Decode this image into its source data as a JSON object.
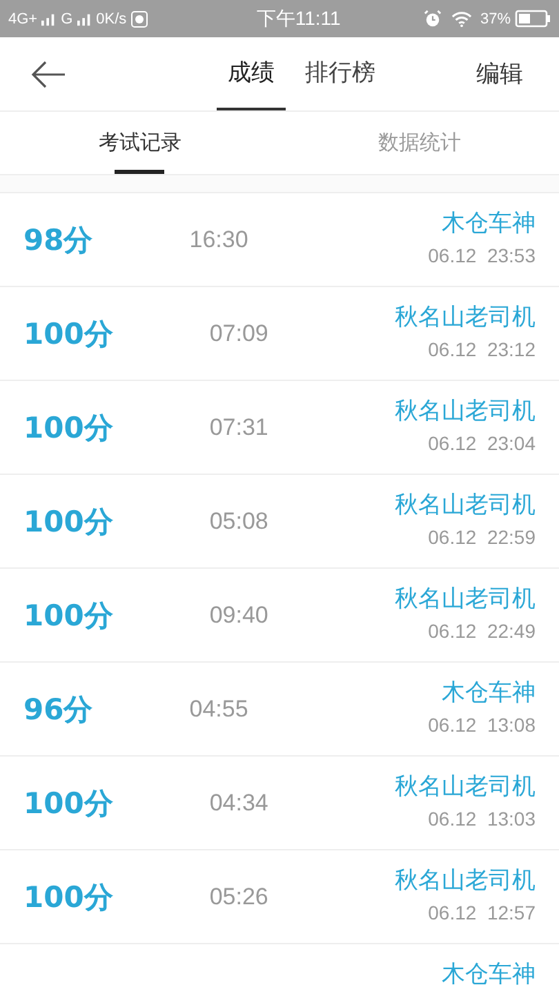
{
  "status_bar": {
    "network_1": "4G+",
    "network_2": "G",
    "speed": "0K/s",
    "time": "下午11:11",
    "battery": "37%"
  },
  "header": {
    "tabs": [
      {
        "label": "成绩",
        "selected": true
      },
      {
        "label": "排行榜",
        "selected": false
      }
    ],
    "edit": "编辑"
  },
  "sub_tabs": [
    {
      "label": "考试记录",
      "selected": true
    },
    {
      "label": "数据统计",
      "selected": false
    }
  ],
  "records": [
    {
      "score": "98分",
      "duration": "16:30",
      "name": "木仓车神",
      "date": "06.12  23:53"
    },
    {
      "score": "100分",
      "duration": "07:09",
      "name": "秋名山老司机",
      "date": "06.12  23:12"
    },
    {
      "score": "100分",
      "duration": "07:31",
      "name": "秋名山老司机",
      "date": "06.12  23:04"
    },
    {
      "score": "100分",
      "duration": "05:08",
      "name": "秋名山老司机",
      "date": "06.12  22:59"
    },
    {
      "score": "100分",
      "duration": "09:40",
      "name": "秋名山老司机",
      "date": "06.12  22:49"
    },
    {
      "score": "96分",
      "duration": "04:55",
      "name": "木仓车神",
      "date": "06.12  13:08"
    },
    {
      "score": "100分",
      "duration": "04:34",
      "name": "秋名山老司机",
      "date": "06.12  13:03"
    },
    {
      "score": "100分",
      "duration": "05:26",
      "name": "秋名山老司机",
      "date": "06.12  12:57"
    },
    {
      "name": "木仓车神"
    }
  ]
}
